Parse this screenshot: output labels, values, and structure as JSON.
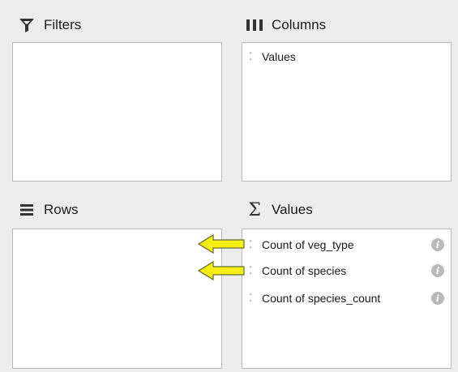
{
  "filters": {
    "title": "Filters",
    "icon": "funnel-icon",
    "items": []
  },
  "columns": {
    "title": "Columns",
    "icon": "columns-icon",
    "items": [
      {
        "label": "Values"
      }
    ]
  },
  "rows": {
    "title": "Rows",
    "icon": "rows-icon",
    "items": []
  },
  "values": {
    "title": "Values",
    "icon": "sigma-icon",
    "items": [
      {
        "label": "Count of veg_type"
      },
      {
        "label": "Count of species"
      },
      {
        "label": "Count of species_count"
      }
    ]
  },
  "annotations": {
    "arrow_color": "#f5ef14",
    "arrow_stroke": "#6b6b2a"
  }
}
